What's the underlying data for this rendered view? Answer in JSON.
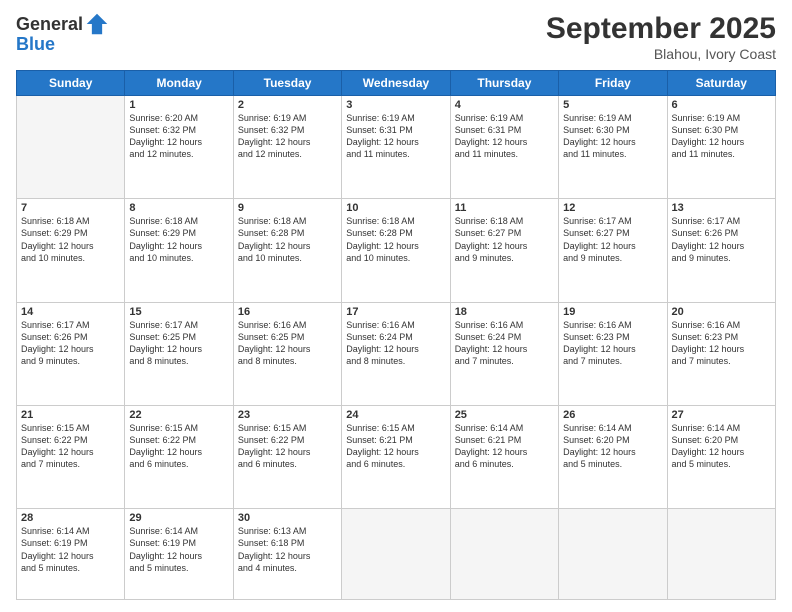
{
  "header": {
    "logo_line1": "General",
    "logo_line2": "Blue",
    "month": "September 2025",
    "location": "Blahou, Ivory Coast"
  },
  "weekdays": [
    "Sunday",
    "Monday",
    "Tuesday",
    "Wednesday",
    "Thursday",
    "Friday",
    "Saturday"
  ],
  "weeks": [
    [
      {
        "day": "",
        "info": ""
      },
      {
        "day": "1",
        "info": "Sunrise: 6:20 AM\nSunset: 6:32 PM\nDaylight: 12 hours\nand 12 minutes."
      },
      {
        "day": "2",
        "info": "Sunrise: 6:19 AM\nSunset: 6:32 PM\nDaylight: 12 hours\nand 12 minutes."
      },
      {
        "day": "3",
        "info": "Sunrise: 6:19 AM\nSunset: 6:31 PM\nDaylight: 12 hours\nand 11 minutes."
      },
      {
        "day": "4",
        "info": "Sunrise: 6:19 AM\nSunset: 6:31 PM\nDaylight: 12 hours\nand 11 minutes."
      },
      {
        "day": "5",
        "info": "Sunrise: 6:19 AM\nSunset: 6:30 PM\nDaylight: 12 hours\nand 11 minutes."
      },
      {
        "day": "6",
        "info": "Sunrise: 6:19 AM\nSunset: 6:30 PM\nDaylight: 12 hours\nand 11 minutes."
      }
    ],
    [
      {
        "day": "7",
        "info": "Sunrise: 6:18 AM\nSunset: 6:29 PM\nDaylight: 12 hours\nand 10 minutes."
      },
      {
        "day": "8",
        "info": "Sunrise: 6:18 AM\nSunset: 6:29 PM\nDaylight: 12 hours\nand 10 minutes."
      },
      {
        "day": "9",
        "info": "Sunrise: 6:18 AM\nSunset: 6:28 PM\nDaylight: 12 hours\nand 10 minutes."
      },
      {
        "day": "10",
        "info": "Sunrise: 6:18 AM\nSunset: 6:28 PM\nDaylight: 12 hours\nand 10 minutes."
      },
      {
        "day": "11",
        "info": "Sunrise: 6:18 AM\nSunset: 6:27 PM\nDaylight: 12 hours\nand 9 minutes."
      },
      {
        "day": "12",
        "info": "Sunrise: 6:17 AM\nSunset: 6:27 PM\nDaylight: 12 hours\nand 9 minutes."
      },
      {
        "day": "13",
        "info": "Sunrise: 6:17 AM\nSunset: 6:26 PM\nDaylight: 12 hours\nand 9 minutes."
      }
    ],
    [
      {
        "day": "14",
        "info": "Sunrise: 6:17 AM\nSunset: 6:26 PM\nDaylight: 12 hours\nand 9 minutes."
      },
      {
        "day": "15",
        "info": "Sunrise: 6:17 AM\nSunset: 6:25 PM\nDaylight: 12 hours\nand 8 minutes."
      },
      {
        "day": "16",
        "info": "Sunrise: 6:16 AM\nSunset: 6:25 PM\nDaylight: 12 hours\nand 8 minutes."
      },
      {
        "day": "17",
        "info": "Sunrise: 6:16 AM\nSunset: 6:24 PM\nDaylight: 12 hours\nand 8 minutes."
      },
      {
        "day": "18",
        "info": "Sunrise: 6:16 AM\nSunset: 6:24 PM\nDaylight: 12 hours\nand 7 minutes."
      },
      {
        "day": "19",
        "info": "Sunrise: 6:16 AM\nSunset: 6:23 PM\nDaylight: 12 hours\nand 7 minutes."
      },
      {
        "day": "20",
        "info": "Sunrise: 6:16 AM\nSunset: 6:23 PM\nDaylight: 12 hours\nand 7 minutes."
      }
    ],
    [
      {
        "day": "21",
        "info": "Sunrise: 6:15 AM\nSunset: 6:22 PM\nDaylight: 12 hours\nand 7 minutes."
      },
      {
        "day": "22",
        "info": "Sunrise: 6:15 AM\nSunset: 6:22 PM\nDaylight: 12 hours\nand 6 minutes."
      },
      {
        "day": "23",
        "info": "Sunrise: 6:15 AM\nSunset: 6:22 PM\nDaylight: 12 hours\nand 6 minutes."
      },
      {
        "day": "24",
        "info": "Sunrise: 6:15 AM\nSunset: 6:21 PM\nDaylight: 12 hours\nand 6 minutes."
      },
      {
        "day": "25",
        "info": "Sunrise: 6:14 AM\nSunset: 6:21 PM\nDaylight: 12 hours\nand 6 minutes."
      },
      {
        "day": "26",
        "info": "Sunrise: 6:14 AM\nSunset: 6:20 PM\nDaylight: 12 hours\nand 5 minutes."
      },
      {
        "day": "27",
        "info": "Sunrise: 6:14 AM\nSunset: 6:20 PM\nDaylight: 12 hours\nand 5 minutes."
      }
    ],
    [
      {
        "day": "28",
        "info": "Sunrise: 6:14 AM\nSunset: 6:19 PM\nDaylight: 12 hours\nand 5 minutes."
      },
      {
        "day": "29",
        "info": "Sunrise: 6:14 AM\nSunset: 6:19 PM\nDaylight: 12 hours\nand 5 minutes."
      },
      {
        "day": "30",
        "info": "Sunrise: 6:13 AM\nSunset: 6:18 PM\nDaylight: 12 hours\nand 4 minutes."
      },
      {
        "day": "",
        "info": ""
      },
      {
        "day": "",
        "info": ""
      },
      {
        "day": "",
        "info": ""
      },
      {
        "day": "",
        "info": ""
      }
    ]
  ]
}
